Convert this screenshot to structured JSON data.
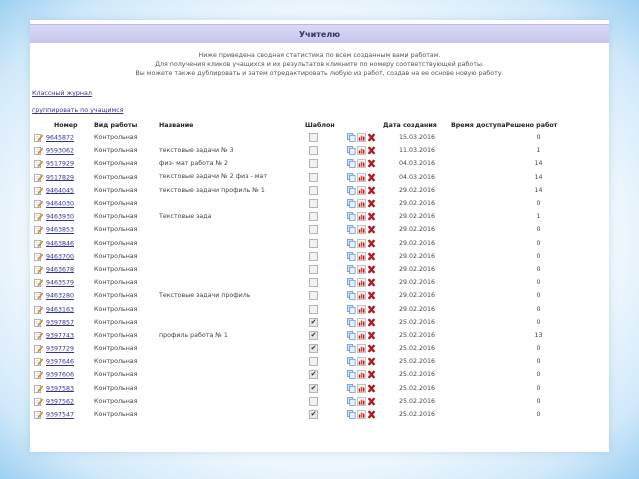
{
  "header": {
    "title": "Учителю"
  },
  "intro": {
    "line1": "Ниже приведена сводная статистика по всем созданным вами работам.",
    "line2": "Для получения кликов учащихся и их результатов кликните по номеру соответствующей работы.",
    "line3": "Вы можете также дублировать и затем отредактировать любую из работ, создав на ее основе новую работу."
  },
  "links": {
    "journal": "Классный журнал",
    "group": "группировать по учащимся"
  },
  "table": {
    "columns": {
      "number": "Номер",
      "type": "Вид работы",
      "name": "Название",
      "template": "Шаблон",
      "created": "Дата создания",
      "access": "Время доступа",
      "solved": "Решено работ"
    },
    "rows": [
      {
        "number": "9645872",
        "type": "Контрольная",
        "name": "",
        "template": false,
        "created": "15.03.2016",
        "solved": "0"
      },
      {
        "number": "9593062",
        "type": "Контрольная",
        "name": "текстовые задачи № 3",
        "template": false,
        "created": "11.03.2016",
        "solved": "1"
      },
      {
        "number": "9517929",
        "type": "Контрольная",
        "name": "физ- мат работа № 2",
        "template": false,
        "created": "04.03.2016",
        "solved": "14"
      },
      {
        "number": "9517829",
        "type": "Контрольная",
        "name": "текстовые задачи № 2 физ - мат",
        "template": false,
        "created": "04.03.2016",
        "solved": "14"
      },
      {
        "number": "9464045",
        "type": "Контрольная",
        "name": "текстовые задачи профиль № 1",
        "template": false,
        "created": "29.02.2016",
        "solved": "14"
      },
      {
        "number": "9464030",
        "type": "Контрольная",
        "name": "",
        "template": false,
        "created": "29.02.2016",
        "solved": "0"
      },
      {
        "number": "9463930",
        "type": "Контрольная",
        "name": "Текстовые зада",
        "template": false,
        "created": "29.02.2016",
        "solved": "1"
      },
      {
        "number": "9463853",
        "type": "Контрольная",
        "name": "",
        "template": false,
        "created": "29.02.2016",
        "solved": "0"
      },
      {
        "number": "9463846",
        "type": "Контрольная",
        "name": "",
        "template": false,
        "created": "29.02.2016",
        "solved": "0"
      },
      {
        "number": "9463700",
        "type": "Контрольная",
        "name": "",
        "template": false,
        "created": "29.02.2016",
        "solved": "0"
      },
      {
        "number": "9463678",
        "type": "Контрольная",
        "name": "",
        "template": false,
        "created": "29.02.2016",
        "solved": "0"
      },
      {
        "number": "9463579",
        "type": "Контрольная",
        "name": "",
        "template": false,
        "created": "29.02.2016",
        "solved": "0"
      },
      {
        "number": "9463280",
        "type": "Контрольная",
        "name": "Текстовые задачи профиль",
        "template": false,
        "created": "29.02.2016",
        "solved": "0"
      },
      {
        "number": "9463163",
        "type": "Контрольная",
        "name": "",
        "template": false,
        "created": "29.02.2016",
        "solved": "0"
      },
      {
        "number": "9397857",
        "type": "Контрольная",
        "name": "",
        "template": true,
        "created": "25.02.2016",
        "solved": "0"
      },
      {
        "number": "9397743",
        "type": "Контрольная",
        "name": "профиль работа № 1",
        "template": true,
        "created": "25.02.2016",
        "solved": "13"
      },
      {
        "number": "9397729",
        "type": "Контрольная",
        "name": "",
        "template": true,
        "created": "25.02.2016",
        "solved": "0"
      },
      {
        "number": "9397646",
        "type": "Контрольная",
        "name": "",
        "template": false,
        "created": "25.02.2016",
        "solved": "0"
      },
      {
        "number": "9397606",
        "type": "Контрольная",
        "name": "",
        "template": true,
        "created": "25.02.2016",
        "solved": "0"
      },
      {
        "number": "9397583",
        "type": "Контрольная",
        "name": "",
        "template": true,
        "created": "25.02.2016",
        "solved": "0"
      },
      {
        "number": "9397562",
        "type": "Контрольная",
        "name": "",
        "template": false,
        "created": "25.02.2016",
        "solved": "0"
      },
      {
        "number": "9397547",
        "type": "Контрольная",
        "name": "",
        "template": true,
        "created": "25.02.2016",
        "solved": "0"
      }
    ]
  },
  "icons": {
    "edit": "edit-pencil-icon",
    "duplicate": "duplicate-icon",
    "stats": "stats-icon",
    "delete": "delete-icon"
  },
  "colors": {
    "title_bar": "#c6c6ee",
    "link": "#333399",
    "delete": "#c0141e"
  }
}
